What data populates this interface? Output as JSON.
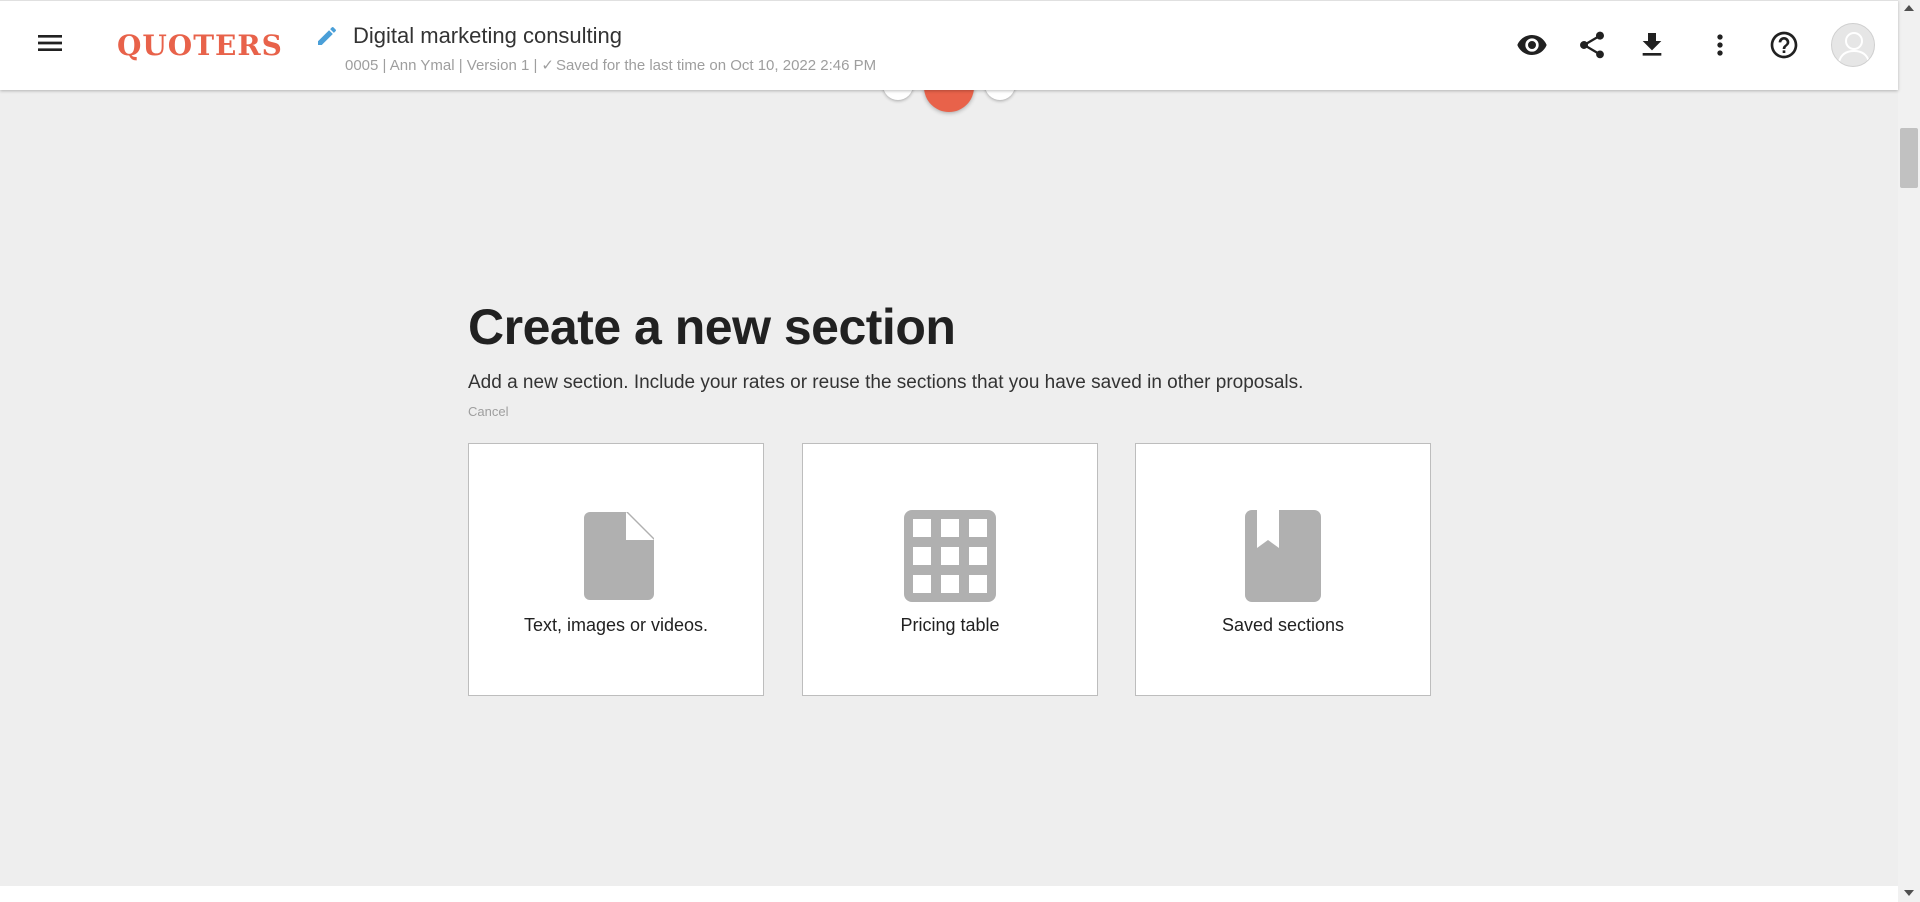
{
  "header": {
    "logo": "QUOTERS",
    "title": "Digital marketing consulting",
    "meta_prefix": "0005 | Ann Ymal | Version 1 |",
    "meta_saved": "Saved for the last time on Oct 10, 2022 2:46 PM"
  },
  "section": {
    "heading": "Create a new section",
    "description": "Add a new section. Include your rates or reuse the sections that you have saved in other proposals.",
    "cancel": "Cancel"
  },
  "cards": [
    {
      "label": "Text, images or videos.",
      "icon": "document-icon"
    },
    {
      "label": "Pricing table",
      "icon": "grid-icon"
    },
    {
      "label": "Saved sections",
      "icon": "bookmark-icon"
    }
  ],
  "colors": {
    "brand": "#e8624a",
    "edit_icon": "#4a9fd8",
    "card_icon": "#b0b0b0",
    "background": "#eeeeee"
  }
}
